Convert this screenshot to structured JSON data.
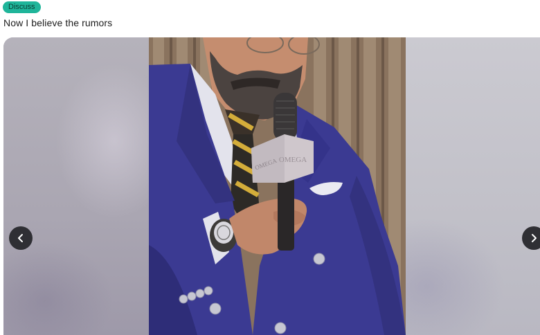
{
  "post": {
    "flair": "Discuss",
    "title": "Now I believe the rumors"
  },
  "gallery": {
    "image_alt": "Bearded man in a navy double-breasted suit holding an OMEGA microphone",
    "mic_brand": "OMEGA",
    "prev_icon": "chevron-left-icon",
    "next_icon": "chevron-right-icon"
  },
  "colors": {
    "flair_bg": "#1fb59a",
    "suit": "#3b3a92",
    "nav_button": "#2f2f34"
  }
}
